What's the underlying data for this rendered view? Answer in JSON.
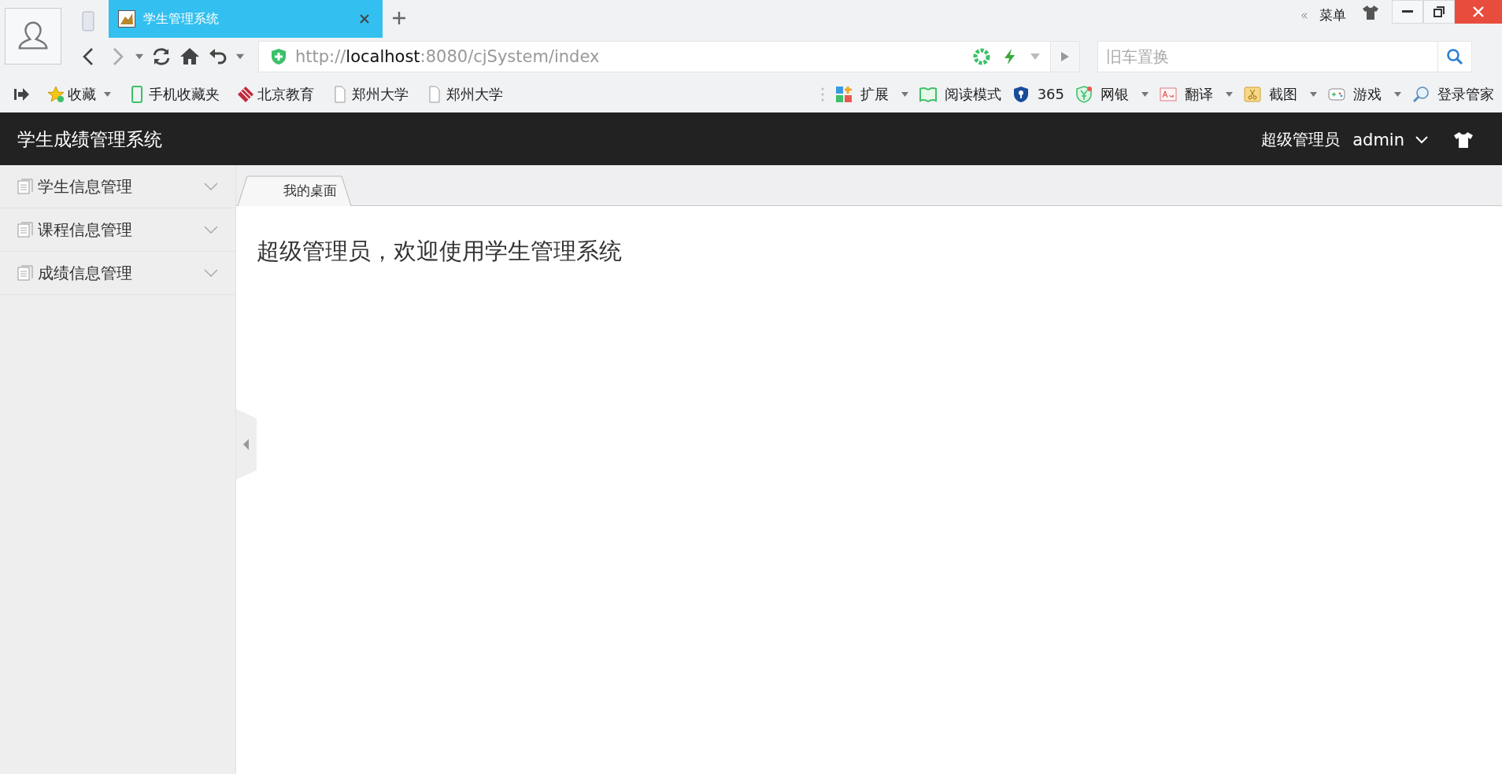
{
  "browser": {
    "tabs": [
      {
        "title": "学生管理系统",
        "selected": true
      }
    ],
    "menu_label": "菜单",
    "url": {
      "scheme": "http://",
      "host": "localhost",
      "path": ":8080/cjSystem/index"
    },
    "search": {
      "placeholder": "旧车置换"
    },
    "bookmarks": [
      {
        "label": "收藏",
        "dropdown": true
      },
      {
        "label": "手机收藏夹",
        "dropdown": false
      },
      {
        "label": "北京教育",
        "dropdown": false
      },
      {
        "label": "郑州大学",
        "dropdown": false
      },
      {
        "label": "郑州大学",
        "dropdown": false
      }
    ],
    "tools": [
      {
        "label": "扩展",
        "dropdown": true
      },
      {
        "label": "阅读模式",
        "dropdown": false
      },
      {
        "label": "365",
        "dropdown": false
      },
      {
        "label": "网银",
        "dropdown": true
      },
      {
        "label": "翻译",
        "dropdown": true
      },
      {
        "label": "截图",
        "dropdown": true
      },
      {
        "label": "游戏",
        "dropdown": true
      },
      {
        "label": "登录管家",
        "dropdown": false
      }
    ]
  },
  "app": {
    "title": "学生成绩管理系统",
    "role": "超级管理员",
    "user": "admin",
    "sidebar": {
      "items": [
        {
          "label": "学生信息管理",
          "expanded": false
        },
        {
          "label": "课程信息管理",
          "expanded": false
        },
        {
          "label": "成绩信息管理",
          "expanded": false
        }
      ]
    },
    "tabs": [
      {
        "label": "我的桌面",
        "selected": true
      }
    ],
    "welcome": "超级管理员，欢迎使用学生管理系统"
  }
}
